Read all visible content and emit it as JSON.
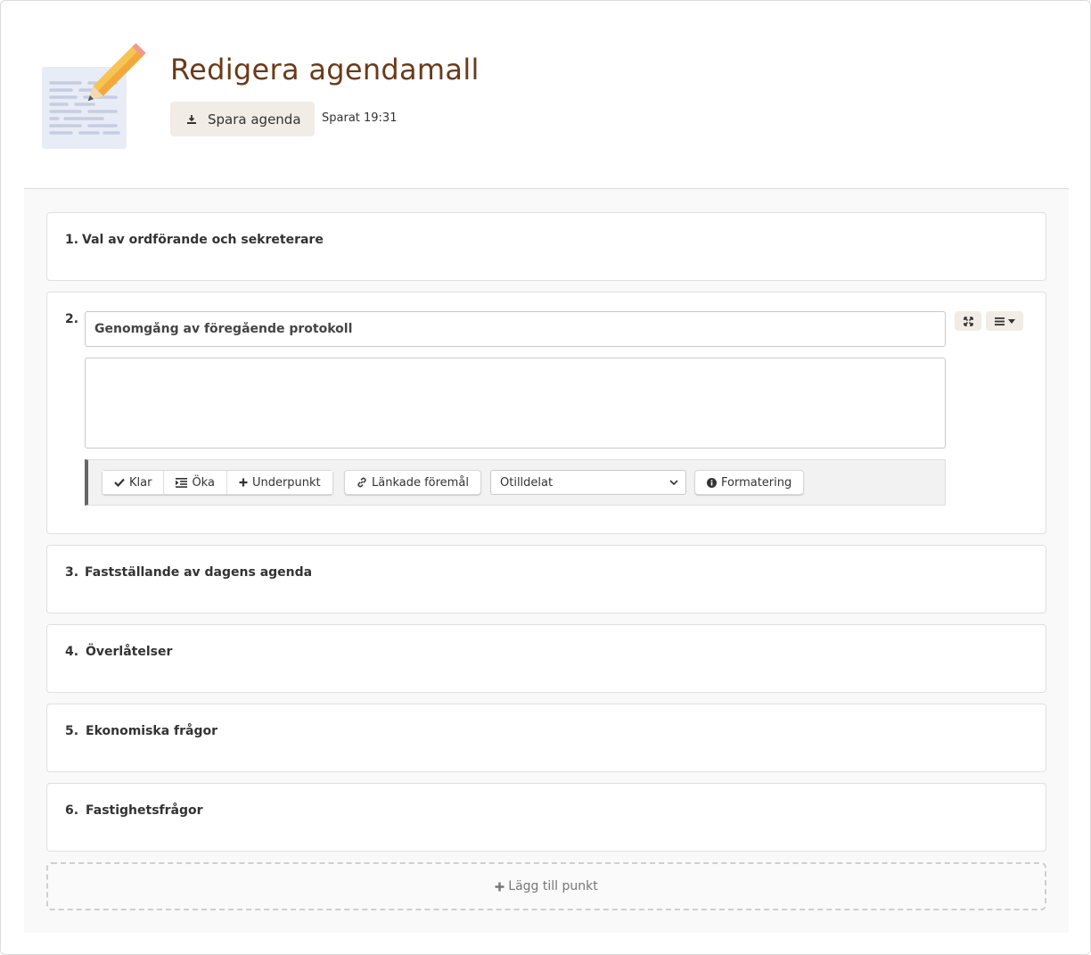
{
  "header": {
    "title": "Redigera agendamall",
    "save_label": "Spara agenda",
    "save_status": "Sparat 19:31"
  },
  "agenda": {
    "items": [
      {
        "number": "1.",
        "title": "Val av ordförande och sekreterare"
      },
      {
        "number": "2.",
        "title": "Genomgång av föregående protokoll",
        "description": ""
      },
      {
        "number": "3.",
        "title": "Fastställande av dagens agenda"
      },
      {
        "number": "4.",
        "title": "Överlåtelser"
      },
      {
        "number": "5.",
        "title": "Ekonomiska frågor"
      },
      {
        "number": "6.",
        "title": "Fastighetsfrågor"
      }
    ],
    "active_item": 2
  },
  "toolbar": {
    "done_label": "Klar",
    "indent_label": "Öka",
    "subitem_label": "Underpunkt",
    "linked_label": "Länkade föremål",
    "assignee_selected": "Otilldelat",
    "formatting_label": "Formatering"
  },
  "add_item_label": "Lägg till punkt",
  "colors": {
    "title": "#6b3a1a",
    "button_bg": "#f1ece6",
    "toolbar_accent": "#666666"
  },
  "icons": {
    "save": "download-icon",
    "done": "check-icon",
    "indent": "indent-icon",
    "subitem": "plus-icon",
    "linked": "link-icon",
    "formatting": "info-icon",
    "expand": "expand-icon",
    "menu": "menu-icon",
    "add": "plus-icon"
  }
}
